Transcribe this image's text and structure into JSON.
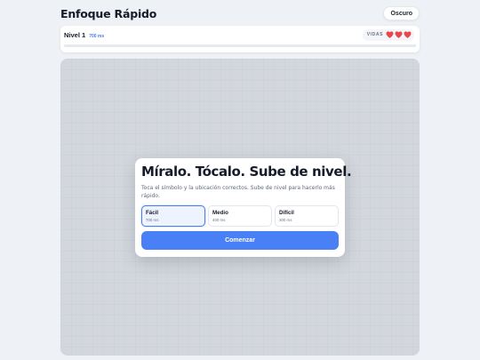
{
  "app": {
    "title": "Enfoque Rápido",
    "theme_toggle_label": "Oscuro"
  },
  "status": {
    "level_label": "Nivel 1",
    "speed_label": "700 ms",
    "lives_label": "VIDAS",
    "lives_count": 3,
    "heart_icon": "heart-icon",
    "progress_fraction": 0
  },
  "modal": {
    "title": "Míralo. Tócalo. Sube de nivel.",
    "subtitle": "Toca el símbolo y la ubicación correctos. Sube de nivel para hacerlo más rápido.",
    "difficulties": [
      {
        "name": "Fácil",
        "speed": "700 ms",
        "selected": true
      },
      {
        "name": "Medio",
        "speed": "400 ms",
        "selected": false
      },
      {
        "name": "Difícil",
        "speed": "300 ms",
        "selected": false
      }
    ],
    "start_label": "Comenzar"
  },
  "colors": {
    "accent": "#4a7df0",
    "heart": "#e5484d",
    "play_area": "#d3d7dd"
  }
}
